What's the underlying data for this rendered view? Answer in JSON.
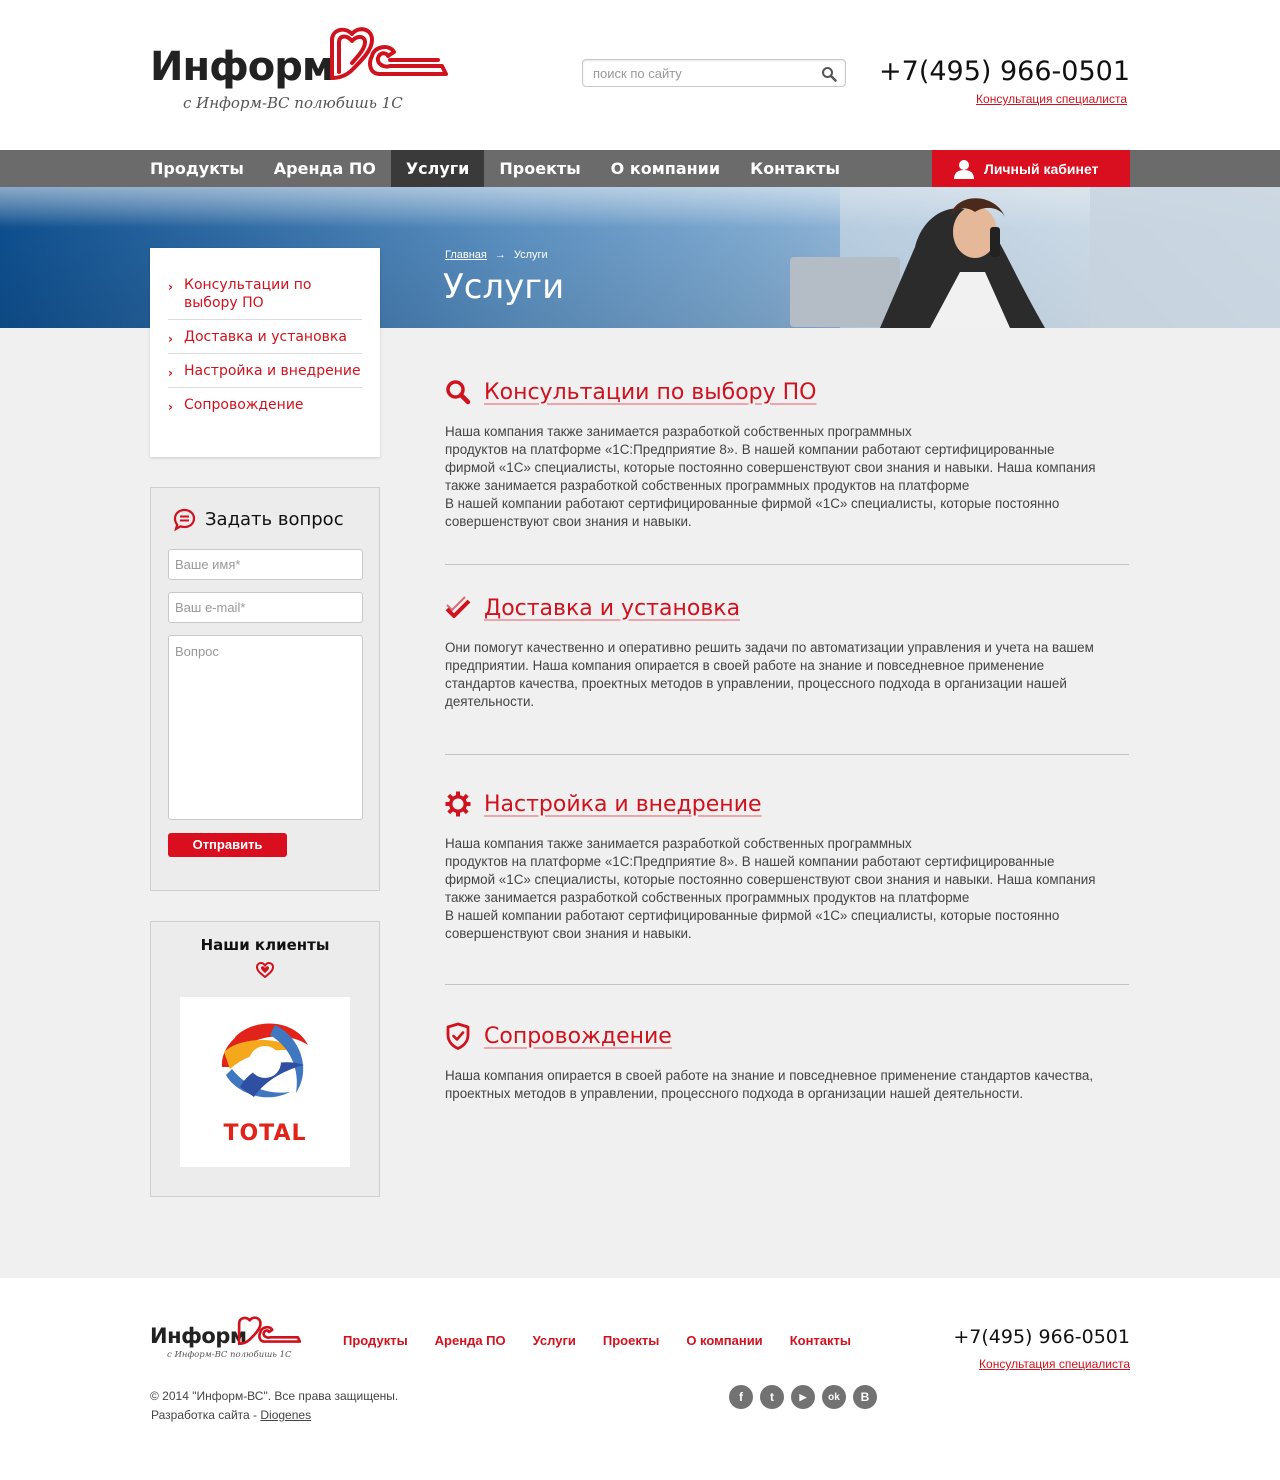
{
  "brand": {
    "name": "Информ",
    "slogan": "с Информ-ВС полюбишь 1С",
    "accent_color": "#d0121e"
  },
  "header": {
    "search_placeholder": "поиск по сайту",
    "phone": "+7(495) 966-0501",
    "consult_link": "Консультация специалиста"
  },
  "nav": {
    "items": [
      "Продукты",
      "Аренда ПО",
      "Услуги",
      "Проекты",
      "О компании",
      "Контакты"
    ],
    "active": "Услуги",
    "cabinet_label": "Личный кабинет"
  },
  "banner": {
    "breadcrumb_home": "Главная",
    "breadcrumb_arrow": "→",
    "breadcrumb_current": "Услуги",
    "title": "Услуги"
  },
  "sidebar": {
    "menu": [
      "Консультации по выбору ПО",
      "Доставка и установка",
      "Настройка и внедрение",
      "Сопровождение"
    ],
    "ask": {
      "title": "Задать вопрос",
      "name_placeholder": "Ваше имя*",
      "email_placeholder": "Ваш e-mail*",
      "question_placeholder": "Вопрос",
      "submit_label": "Отправить"
    },
    "clients": {
      "title": "Наши клиенты",
      "logo_text": "TOTAL"
    }
  },
  "services": [
    {
      "icon": "search-icon",
      "title": "Консультации по выбору ПО",
      "text": "Наша компания также занимается разработкой собственных программных\nпродуктов на платформе «1С:Предприятие 8». В нашей компании работают сертифицированные фирмой «1С» специалисты, которые постоянно совершенствуют свои знания и навыки. Наша компания также занимается разработкой собственных программных продуктов на платформе\nВ нашей компании работают сертифицированные фирмой «1С» специалисты, которые постоянно совершенствуют свои знания и навыки."
    },
    {
      "icon": "check-icon",
      "title": "Доставка и установка",
      "text": "Они помогут качественно и оперативно решить задачи по автоматизации управления и учета на вашем предприятии. Наша компания опирается в своей работе на знание и повседневное применение стандартов качества, проектных методов в управлении, процессного подхода в организации нашей деятельности."
    },
    {
      "icon": "gear-icon",
      "title": "Настройка и внедрение",
      "text": "Наша компания также занимается разработкой собственных программных\nпродуктов на платформе «1С:Предприятие 8». В нашей компании работают сертифицированные фирмой «1С» специалисты, которые постоянно совершенствуют свои знания и навыки. Наша компания также занимается разработкой собственных программных продуктов на платформе\nВ нашей компании работают сертифицированные фирмой «1С» специалисты, которые постоянно совершенствуют свои знания и навыки."
    },
    {
      "icon": "shield-icon",
      "title": "Сопровождение",
      "text": "Наша компания опирается в своей работе на знание и повседневное применение стандартов качества, проектных методов в управлении, процессного подхода в организации нашей деятельности."
    }
  ],
  "footer": {
    "nav": [
      "Продукты",
      "Аренда ПО",
      "Услуги",
      "Проекты",
      "О компании",
      "Контакты"
    ],
    "phone": "+7(495) 966-0501",
    "consult_link": "Консультация специалиста",
    "copyright": "© 2014 \"Информ-ВС\". Все права защищены.",
    "dev_prefix": "Разработка сайта - ",
    "dev_link": "Diogenes",
    "socials": [
      {
        "icon": "facebook-icon",
        "glyph": "f"
      },
      {
        "icon": "twitter-icon",
        "glyph": "t"
      },
      {
        "icon": "youtube-icon",
        "glyph": "▶"
      },
      {
        "icon": "odnoklassniki-icon",
        "glyph": "ok"
      },
      {
        "icon": "vkontakte-icon",
        "glyph": "B"
      }
    ]
  }
}
